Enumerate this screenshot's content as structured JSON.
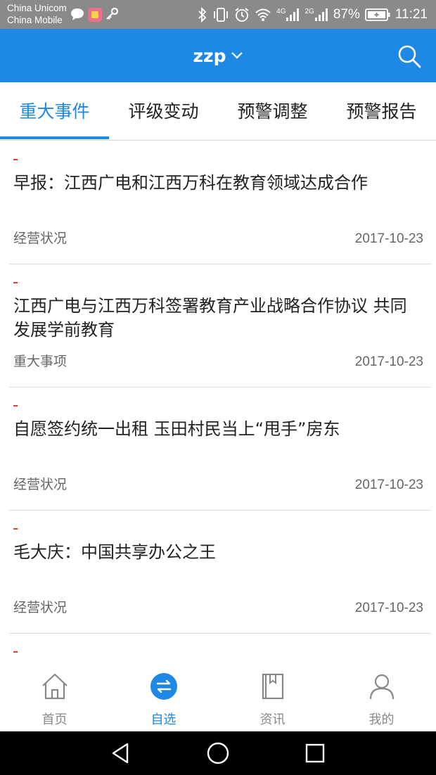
{
  "status_bar": {
    "carrier1": "China Unicom",
    "carrier2": "China Mobile",
    "net1": "4G",
    "net2": "2G",
    "battery": "87%",
    "time": "11:21",
    "icons": [
      "message-icon",
      "app-notification-icon",
      "key-icon",
      "bluetooth-icon",
      "vibrate-icon",
      "alarm-icon",
      "wifi-icon",
      "signal-icon",
      "battery-icon"
    ]
  },
  "app_bar": {
    "title": "zzp",
    "accent": "#1e88e5"
  },
  "tabs": [
    {
      "label": "重大事件",
      "active": true
    },
    {
      "label": "评级变动",
      "active": false
    },
    {
      "label": "预警调整",
      "active": false
    },
    {
      "label": "预警报告",
      "active": false
    }
  ],
  "news": [
    {
      "marker": "-",
      "title": "早报：江西广电和江西万科在教育领域达成合作",
      "category": "经营状况",
      "date": "2017-10-23"
    },
    {
      "marker": "-",
      "title": "江西广电与江西万科签署教育产业战略合作协议 共同发展学前教育",
      "category": "重大事项",
      "date": "2017-10-23"
    },
    {
      "marker": "-",
      "title": "自愿签约统一出租 玉田村民当上“甩手”房东",
      "category": "经营状况",
      "date": "2017-10-23"
    },
    {
      "marker": "-",
      "title": "毛大庆：中国共享办公之王",
      "category": "经营状况",
      "date": "2017-10-23"
    },
    {
      "marker": "-"
    }
  ],
  "bottom_nav": [
    {
      "label": "首页",
      "icon": "home-icon",
      "active": false
    },
    {
      "label": "自选",
      "icon": "exchange-icon",
      "active": true
    },
    {
      "label": "资讯",
      "icon": "book-icon",
      "active": false
    },
    {
      "label": "我的",
      "icon": "user-icon",
      "active": false
    }
  ],
  "system_nav": [
    "back-icon",
    "home-circle-icon",
    "recents-icon"
  ]
}
